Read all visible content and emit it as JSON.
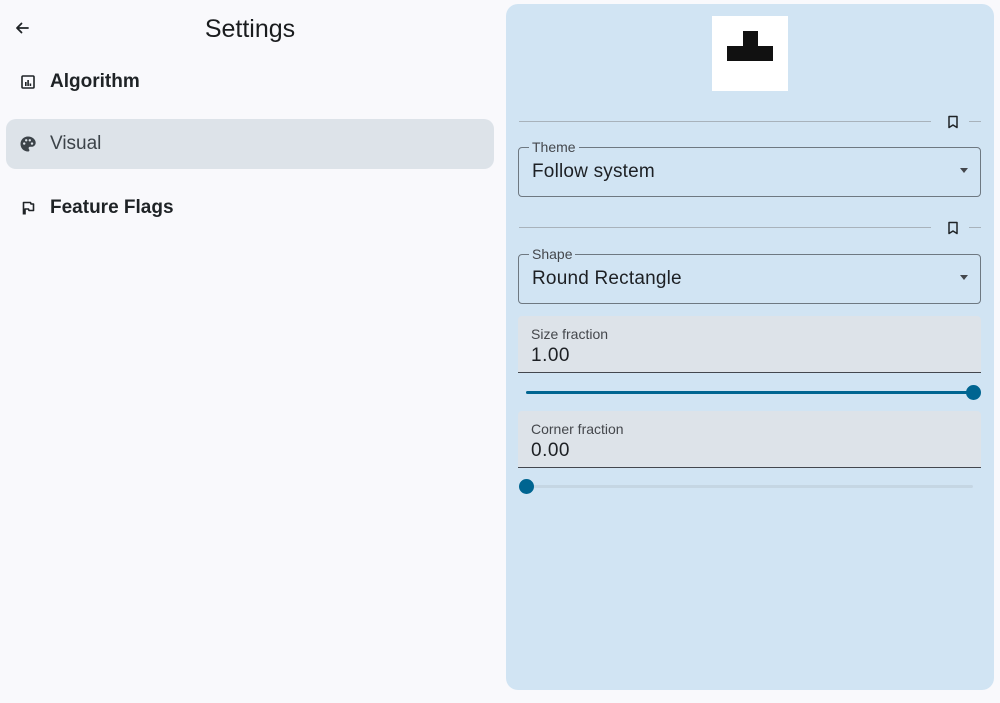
{
  "header": {
    "title": "Settings",
    "back_icon": "arrow-back-icon"
  },
  "nav": {
    "items": [
      {
        "label": "Algorithm",
        "icon": "chart-icon",
        "active": false
      },
      {
        "label": "Visual",
        "icon": "palette-icon",
        "active": true
      },
      {
        "label": "Feature Flags",
        "icon": "flag-icon",
        "active": false
      }
    ]
  },
  "panel": {
    "preview_icon": "shape-preview-icon",
    "theme": {
      "label": "Theme",
      "value": "Follow system"
    },
    "shape": {
      "label": "Shape",
      "value": "Round Rectangle"
    },
    "size_fraction": {
      "label": "Size fraction",
      "value": "1.00",
      "slider_value": 1.0
    },
    "corner_fraction": {
      "label": "Corner fraction",
      "value": "0.00",
      "slider_value": 0.0
    }
  },
  "colors": {
    "background": "#f9f9fc",
    "panel": "#d1e4f3",
    "active_item": "#dde3e9",
    "accent": "#006591"
  }
}
